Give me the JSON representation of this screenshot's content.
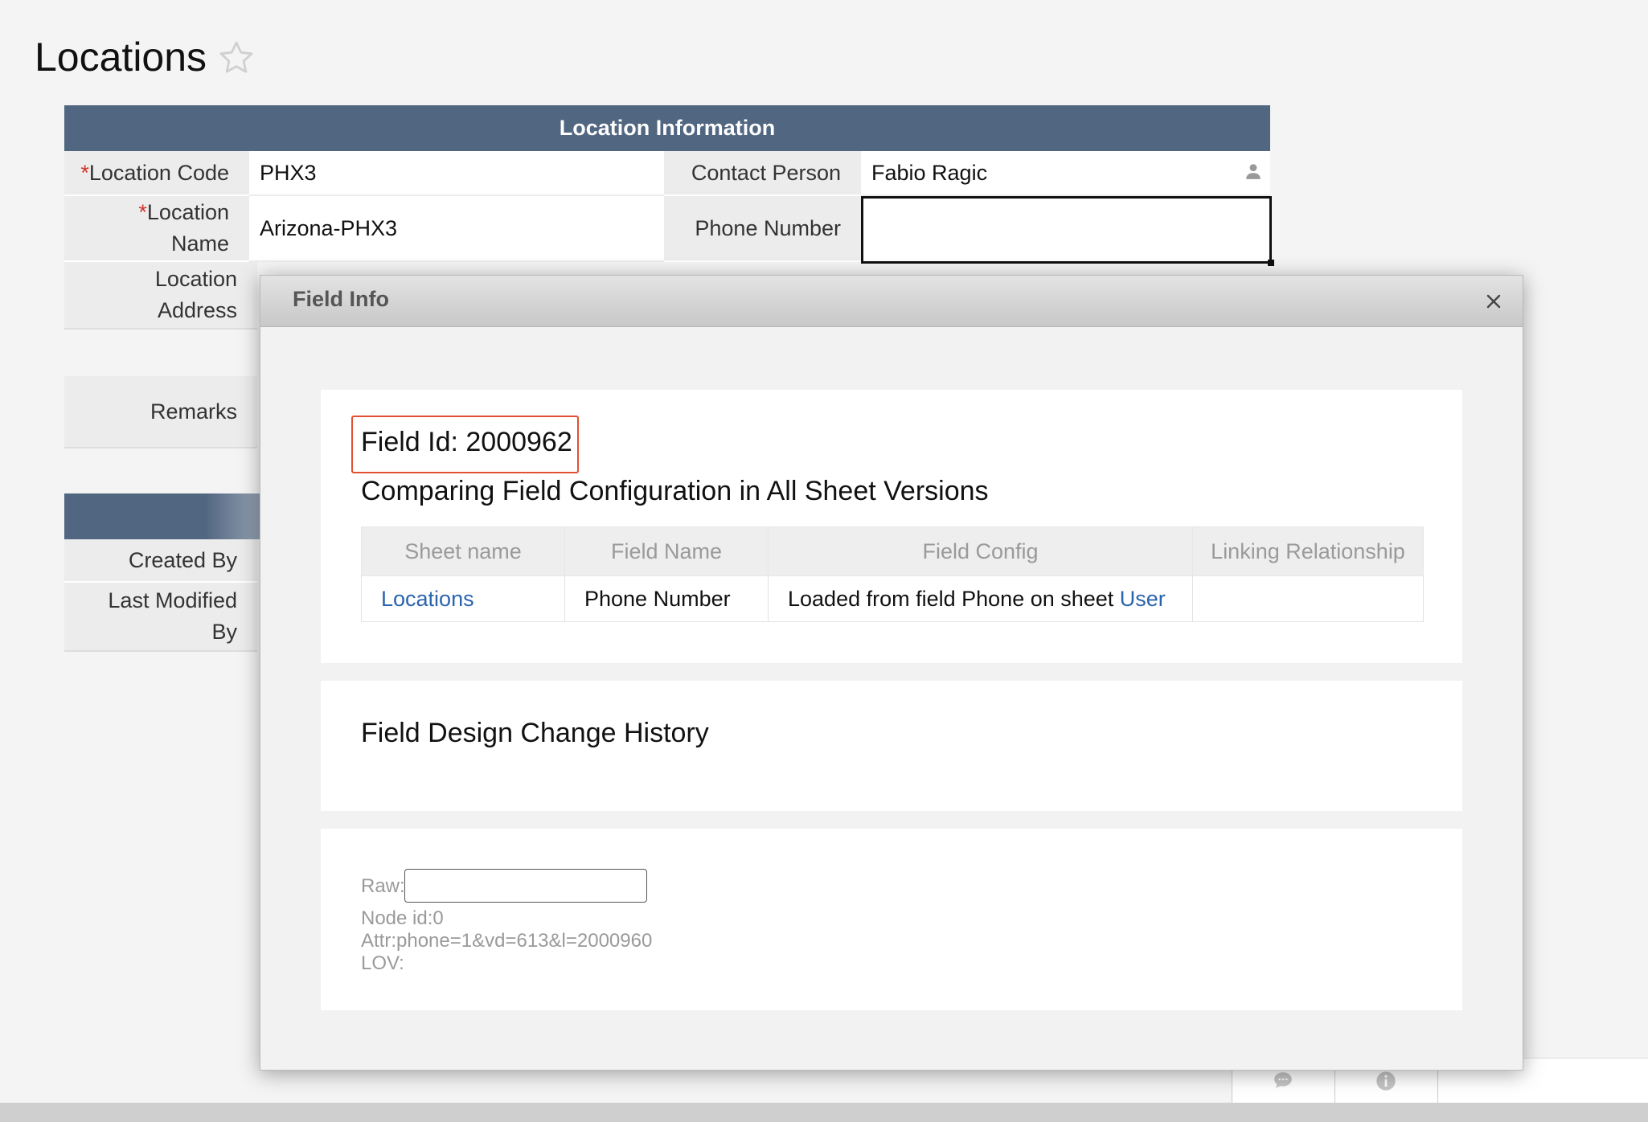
{
  "page": {
    "title": "Locations"
  },
  "location_info": {
    "header": "Location Information",
    "fields": [
      {
        "required": "*",
        "label": "Location Code",
        "value": "PHX3"
      },
      {
        "required": "*",
        "label_line1": "Location",
        "label_line2": "Name",
        "value": "Arizona-PHX3"
      },
      {
        "label_line1": "Location",
        "label_line2": "Address"
      },
      {
        "label": "Remarks"
      }
    ],
    "contact_person": {
      "label": "Contact Person",
      "value": "Fabio Ragic"
    },
    "phone_number": {
      "label": "Phone Number",
      "value": ""
    }
  },
  "record_info": {
    "created_by_label": "Created By",
    "last_modified_line1": "Last Modified",
    "last_modified_line2": "By"
  },
  "dialog": {
    "title": "Field Info",
    "field_id": "Field Id: 2000962",
    "compare_heading": "Comparing Field Configuration in All Sheet Versions",
    "table": {
      "headers": [
        "Sheet name",
        "Field Name",
        "Field Config",
        "Linking Relationship"
      ],
      "rows": [
        {
          "sheet_name": "Locations",
          "field_name": "Phone Number",
          "field_config_text": "Loaded from field Phone on sheet ",
          "field_config_link": "User",
          "linking_relationship": ""
        }
      ]
    },
    "history_heading": "Field Design Change History",
    "debug": {
      "raw_label": "Raw:",
      "raw_value": "",
      "node_id": "Node id:0",
      "attr": "Attr:phone=1&vd=613&l=2000960",
      "lov": "LOV:"
    }
  },
  "colors": {
    "header_bg": "#516680",
    "link": "#2a64ad",
    "highlight_box": "#e2502f",
    "required": "#d2322d"
  },
  "icons": [
    "star-icon",
    "person-icon",
    "close-icon",
    "chat-icon",
    "info-icon"
  ]
}
